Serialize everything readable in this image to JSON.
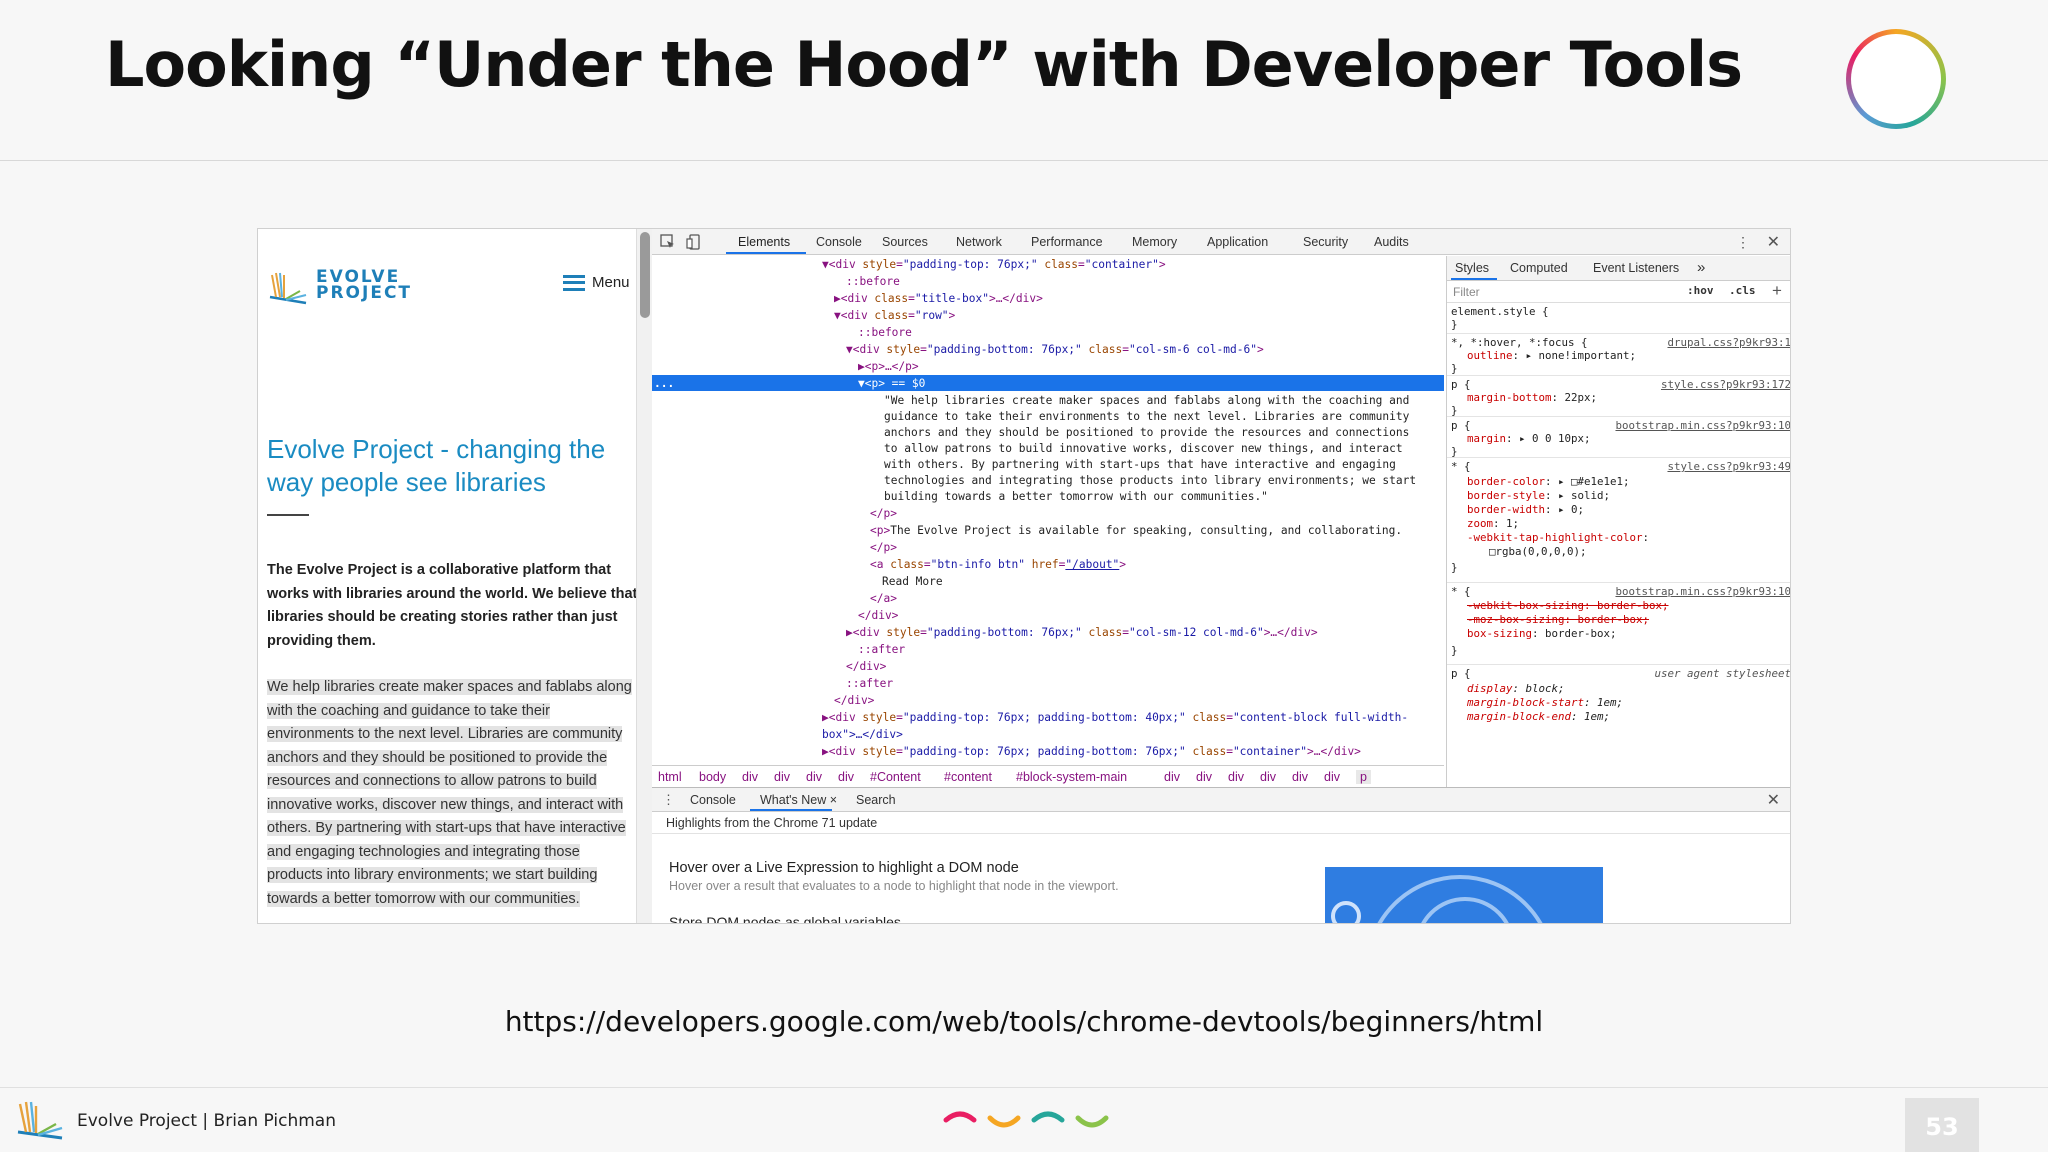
{
  "slide": {
    "title": "Looking “Under the Hood” with Developer Tools",
    "url": "https://developers.google.com/web/tools/chrome-devtools/beginners/html",
    "footer": "Evolve Project | Brian Pichman",
    "page_number": "53"
  },
  "site": {
    "logo_line1": "EVOLVE",
    "logo_line2": "PROJECT",
    "menu_label": "Menu",
    "heading": "Evolve Project - changing the way people see libraries",
    "intro": "The Evolve Project is a collaborative platform that works with libraries around the world. We believe that libraries should be creating stories rather than just providing them.",
    "selected_para": "We help libraries create maker spaces and fablabs along with the coaching and guidance to take their environments to the next level. Libraries are community anchors and they should be positioned to provide the resources and connections to allow patrons to build innovative works, discover new things, and interact with others. By partnering with start-ups that have interactive and engaging technologies and integrating those products into library environments; we start building towards a better tomorrow with our communities."
  },
  "devtools": {
    "tabs": [
      "Elements",
      "Console",
      "Sources",
      "Network",
      "Performance",
      "Memory",
      "Application",
      "Security",
      "Audits"
    ],
    "active_tab": "Elements",
    "elements_lines": {
      "l1_tag": "▼<div ",
      "l1_a1": "style",
      "l1_v1": "\"padding-top: 76px;\"",
      "l1_a2": "class",
      "l1_v2": "\"container\"",
      "l2": "::before",
      "l3_tag": "▶<div ",
      "l3_a": "class",
      "l3_v": "\"title-box\"",
      "l3_end": ">…</div>",
      "l4_tag": "▼<div ",
      "l4_a": "class",
      "l4_v": "\"row\"",
      "l5": "::before",
      "l6_tag": "▼<div ",
      "l6_a1": "style",
      "l6_v1": "\"padding-bottom: 76px;\"",
      "l6_a2": "class",
      "l6_v2": "\"col-sm-6 col-md-6\"",
      "l7": "▶<p>…</p>",
      "sel_dots": "...",
      "sel": "▼<p> == $0",
      "para": [
        "\"We help libraries create maker spaces and fablabs along with the coaching and",
        "guidance to take their environments to the next level. Libraries are community",
        "anchors and they should be positioned to provide the resources and connections",
        "to allow patrons to build innovative works, discover new things, and interact",
        "with others. By partnering with start-ups that have interactive and engaging",
        "technologies and integrating those products into library environments; we start",
        "building towards a better tomorrow with our communities.\""
      ],
      "l_pclose": "</p>",
      "l_p2_open": "<p>",
      "l_p2_text": "The Evolve Project is available for speaking, consulting, and collaborating.",
      "l_p2_close": "</p>",
      "l_a_tag": "<a ",
      "l_a_a1": "class",
      "l_a_v1": "\"btn-info btn\"",
      "l_a_a2": "href",
      "l_a_v2": "\"/about\"",
      "l_read": "Read More",
      "l_aclose": "</a>",
      "l_divclose1": "</div>",
      "l_div2_tag": "▶<div ",
      "l_div2_a1": "style",
      "l_div2_v1": "\"padding-bottom: 76px;\"",
      "l_div2_a2": "class",
      "l_div2_v2": "\"col-sm-12 col-md-6\"",
      "l_div2_end": ">…</div>",
      "l_after1": "::after",
      "l_divclose2": "</div>",
      "l_after2": "::after",
      "l_divclose3": "</div>",
      "l_div3_tag": "▶<div ",
      "l_div3_a1": "style",
      "l_div3_v1": "\"padding-top: 76px; padding-bottom: 40px;\"",
      "l_div3_a2": "class",
      "l_div3_v2": "\"content-block full-width-",
      "l_div3_cont": "box\">…</div>",
      "l_div4_tag": "▶<div ",
      "l_div4_a1": "style",
      "l_div4_v1": "\"padding-top: 76px; padding-bottom: 76px;\"",
      "l_div4_a2": "class",
      "l_div4_v2": "\"container\"",
      "l_div4_end": ">…</div>"
    },
    "breadcrumbs": [
      "html",
      "body",
      "div",
      "div",
      "div",
      "div",
      "#Content",
      "#content",
      "#block-system-main",
      "div",
      "div",
      "div",
      "div",
      "div",
      "div",
      "p"
    ],
    "styles_tabs": [
      "Styles",
      "Computed",
      "Event Listeners"
    ],
    "filter_placeholder": "Filter",
    "hov": ":hov",
    "cls": ".cls",
    "rules": {
      "r0_sel": "element.style {",
      "r0_end": "}",
      "r1_sel": "*, *:hover, *:focus {",
      "r1_src": "drupal.css?p9kr93:1",
      "r1_p": "outline",
      "r1_v": ": ▸ none!important;",
      "r1_end": "}",
      "r2_sel": "p {",
      "r2_src": "style.css?p9kr93:172",
      "r2_p": "margin-bottom",
      "r2_v": ": 22px;",
      "r2_end": "}",
      "r3_sel": "p {",
      "r3_src": "bootstrap.min.css?p9kr93:10",
      "r3_p": "margin",
      "r3_v": ": ▸ 0 0 10px;",
      "r3_end": "}",
      "r4_sel": "* {",
      "r4_src": "style.css?p9kr93:49",
      "r4_p1": "border-color",
      "r4_v1": ": ▸ □#e1e1e1;",
      "r4_p2": "border-style",
      "r4_v2": ": ▸ solid;",
      "r4_p3": "border-width",
      "r4_v3": ": ▸ 0;",
      "r4_p4": "zoom",
      "r4_v4": ": 1;",
      "r4_p5": "-webkit-tap-highlight-color",
      "r4_v5": ":",
      "r4_v5b": "□rgba(0,0,0,0);",
      "r4_end": "}",
      "r5_sel": "* {",
      "r5_src": "bootstrap.min.css?p9kr93:10",
      "r5_s1": "-webkit-box-sizing: border-box;",
      "r5_s2": "-moz-box-sizing: border-box;",
      "r5_p": "box-sizing",
      "r5_v": ": border-box;",
      "r5_end": "}",
      "r6_sel": "p {",
      "r6_src": "user agent stylesheet",
      "r6_p1": "display",
      "r6_v1": ": block;",
      "r6_p2": "margin-block-start",
      "r6_v2": ": 1em;",
      "r6_p3": "margin-block-end",
      "r6_v3": ": 1em;"
    },
    "drawer": {
      "tabs": [
        "Console",
        "What's New ×",
        "Search"
      ],
      "header": "Highlights from the Chrome 71 update",
      "news_title": "Hover over a Live Expression to highlight a DOM node",
      "news_sub": "Hover over a result that evaluates to a node to highlight that node in the viewport.",
      "news_next": "Store DOM nodes as global variables"
    }
  },
  "colors": {
    "accent_blue": "#1a73e8",
    "site_heading": "#1a8bc2",
    "tag_purple": "#881280",
    "attr_brown": "#994500",
    "value_blue": "#1a1aa6",
    "prop_red": "#c80000"
  }
}
